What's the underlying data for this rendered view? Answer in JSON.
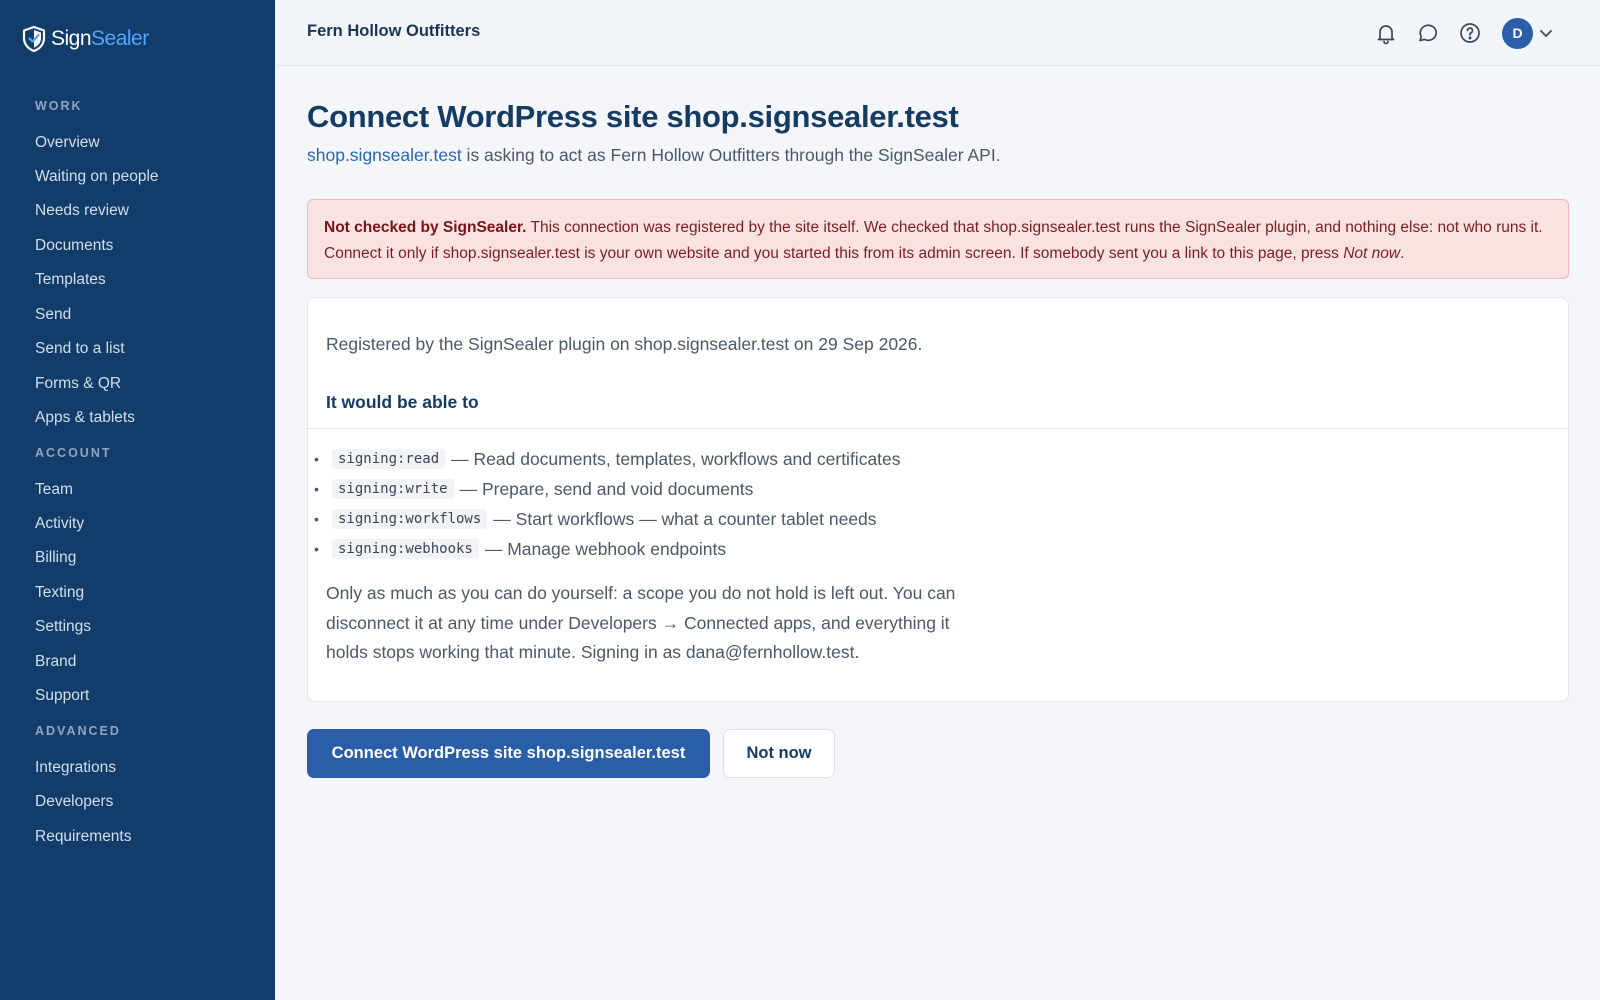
{
  "brand": {
    "name_part1": "Sign",
    "name_part2": "Sealer",
    "logo_icon": "shield-check-icon"
  },
  "sidebar": {
    "sections": [
      {
        "label": "WORK",
        "items": [
          "Overview",
          "Waiting on people",
          "Needs review",
          "Documents",
          "Templates",
          "Send",
          "Send to a list",
          "Forms & QR",
          "Apps & tablets"
        ]
      },
      {
        "label": "ACCOUNT",
        "items": [
          "Team",
          "Activity",
          "Billing",
          "Texting",
          "Settings",
          "Brand",
          "Support"
        ]
      },
      {
        "label": "ADVANCED",
        "items": [
          "Integrations",
          "Developers",
          "Requirements"
        ]
      }
    ]
  },
  "header": {
    "org_name": "Fern Hollow Outfitters",
    "icons": [
      "bell-icon",
      "chat-icon",
      "help-icon"
    ],
    "avatar_initial": "D"
  },
  "main": {
    "title": "Connect WordPress site shop.signsealer.test",
    "subtitle_link": "shop.signsealer.test",
    "subtitle_rest": " is asking to act as Fern Hollow Outfitters through the SignSealer API.",
    "alert": {
      "bold": "Not checked by SignSealer.",
      "text": " This connection was registered by the site itself. We checked that shop.signsealer.test runs the SignSealer plugin, and nothing else: not who runs it. Connect it only if shop.signsealer.test is your own website and you started this from its admin screen. If somebody sent you a link to this page, press ",
      "italic": "Not now",
      "end": "."
    },
    "card": {
      "registered": "Registered by the SignSealer plugin on shop.signsealer.test on 29 Sep 2026.",
      "heading": "It would be able to",
      "scopes": [
        {
          "code": "signing:read",
          "desc": "— Read documents, templates, workflows and certificates"
        },
        {
          "code": "signing:write",
          "desc": "— Prepare, send and void documents"
        },
        {
          "code": "signing:workflows",
          "desc": "— Start workflows — what a counter tablet needs"
        },
        {
          "code": "signing:webhooks",
          "desc": "— Manage webhook endpoints"
        }
      ],
      "note": "Only as much as you can do yourself: a scope you do not hold is left out. You can disconnect it at any time under Developers → Connected apps, and everything it holds stops working that minute. Signing in as dana@fernhollow.test."
    },
    "buttons": {
      "connect": "Connect WordPress site shop.signsealer.test",
      "not_now": "Not now"
    }
  }
}
